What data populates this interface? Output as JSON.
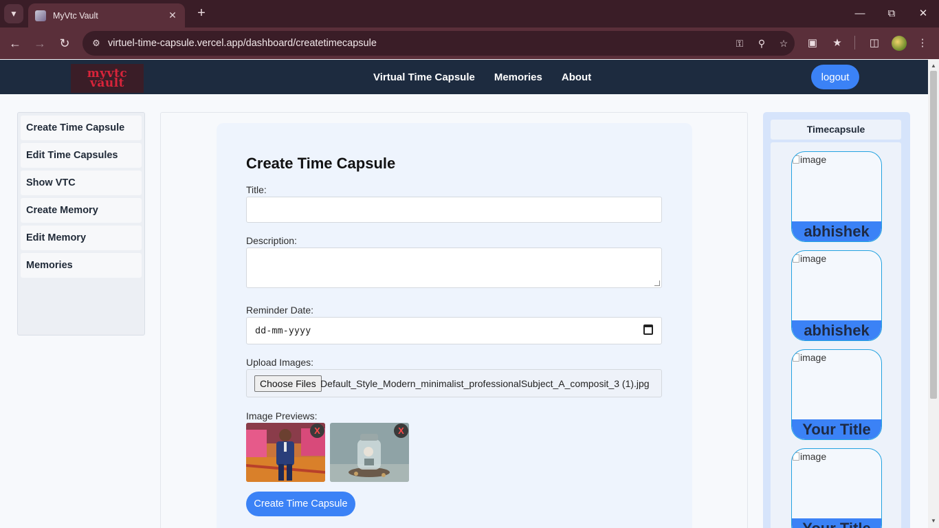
{
  "browser": {
    "tab_title": "MyVtc Vault",
    "url": "virtuel-time-capsule.vercel.app/dashboard/createtimecapsule"
  },
  "navbar": {
    "logo_line1": "myvtc",
    "logo_line2": "vault",
    "links": [
      "Virtual Time Capsule",
      "Memories",
      "About"
    ],
    "logout_label": "logout"
  },
  "sidebar": {
    "items": [
      "Create Time Capsule",
      "Edit Time Capsules",
      "Show VTC",
      "Create Memory",
      "Edit Memory",
      "Memories"
    ]
  },
  "form": {
    "heading": "Create Time Capsule",
    "title_label": "Title:",
    "title_value": "",
    "description_label": "Description:",
    "description_value": "",
    "reminder_label": "Reminder Date:",
    "reminder_placeholder": "dd-mm-yyyy",
    "upload_label": "Upload Images:",
    "choose_files_label": "Choose Files",
    "file_name": "Default_Style_Modern_minimalist_professionalSubject_A_composit_3 (1).jpg",
    "previews_label": "Image Previews:",
    "remove_label": "X",
    "submit_label": "Create Time Capsule"
  },
  "right_panel": {
    "header": "Timecapsule",
    "image_alt": "image",
    "capsules": [
      {
        "title": "abhishek"
      },
      {
        "title": "abhishek"
      },
      {
        "title": "Your Title"
      },
      {
        "title": "Your Title"
      }
    ]
  },
  "colors": {
    "chrome_dark": "#3a1d27",
    "chrome_bar": "#5a2f3a",
    "navbar_bg": "#1d2b3f",
    "accent": "#3b82f6",
    "logo_red": "#d8243a"
  },
  "icons": {
    "back": "arrow-left-icon",
    "forward": "arrow-right-icon",
    "reload": "reload-icon",
    "key": "key-icon",
    "zoom": "zoom-icon",
    "bookmark": "star-icon",
    "calendar": "calendar-icon"
  }
}
